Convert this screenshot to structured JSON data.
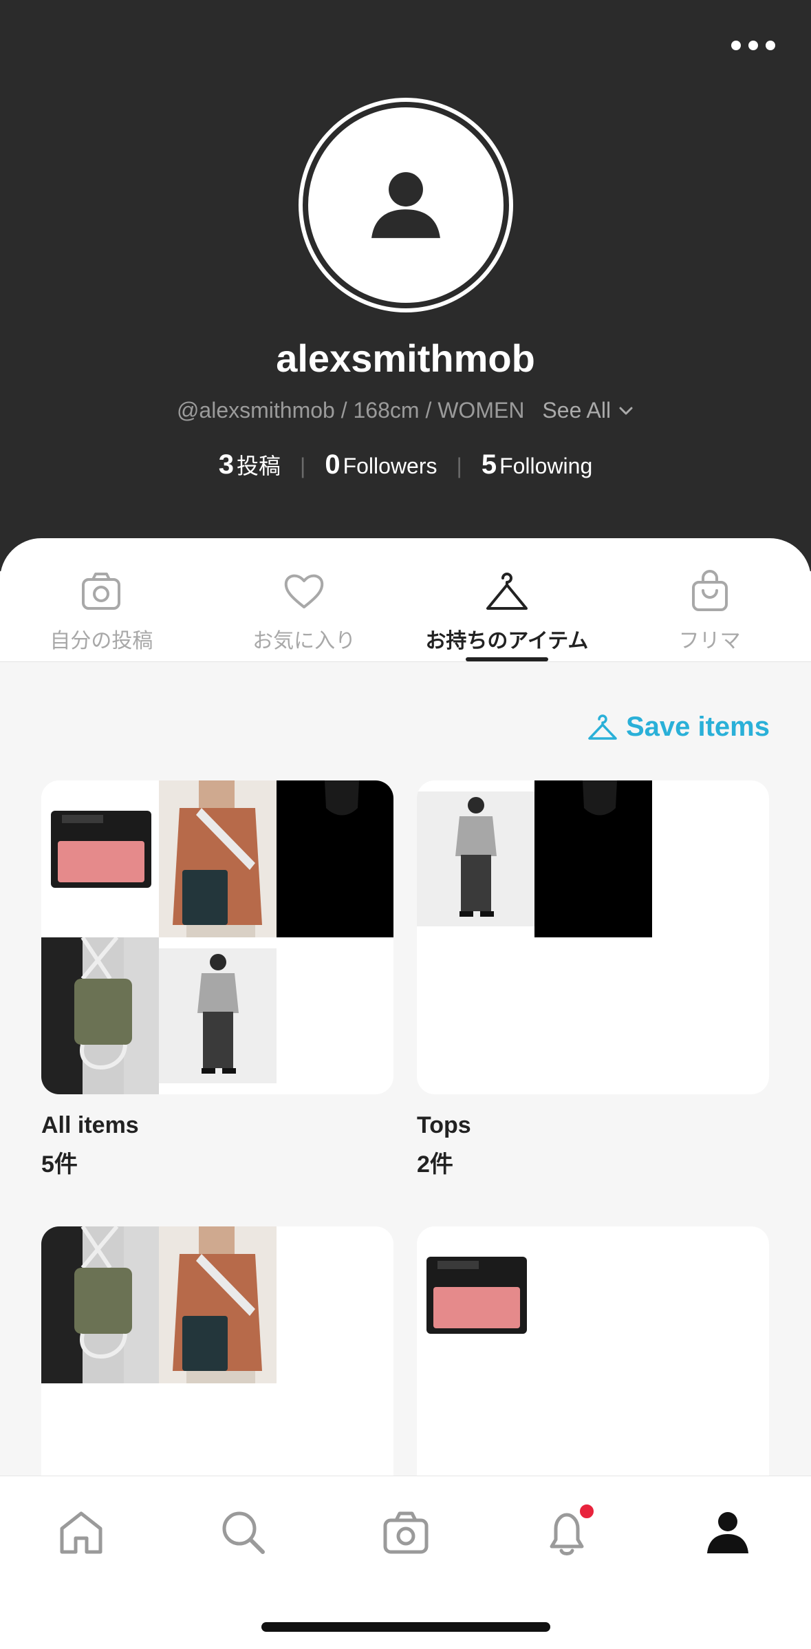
{
  "header": {
    "username": "alexsmithmob",
    "meta": "@alexsmithmob / 168cm / WOMEN",
    "see_all": "See All",
    "stats": [
      {
        "num": "3",
        "label": "投稿"
      },
      {
        "num": "0",
        "label": "Followers"
      },
      {
        "num": "5",
        "label": "Following"
      }
    ]
  },
  "tabs": [
    {
      "label": "自分の投稿",
      "icon": "camera-icon"
    },
    {
      "label": "お気に入り",
      "icon": "heart-icon"
    },
    {
      "label": "お持ちのアイテム",
      "icon": "hanger-icon",
      "active": true
    },
    {
      "label": "フリマ",
      "icon": "shopping-bag-icon"
    }
  ],
  "save_items": "Save items",
  "collections": [
    {
      "title": "All items",
      "count": "5件"
    },
    {
      "title": "Tops",
      "count": "2件"
    },
    {
      "title": "",
      "count": ""
    },
    {
      "title": "",
      "count": ""
    }
  ],
  "colors": {
    "header_bg": "#2b2b2b",
    "accent": "#2ab0d8",
    "badge": "#e8233c",
    "blush": "#e58a8b",
    "vest": "#b76a4a",
    "bag_green": "#6b7254"
  },
  "bottom_nav": [
    "home-icon",
    "search-icon",
    "camera-icon",
    "bell-icon",
    "profile-icon"
  ]
}
